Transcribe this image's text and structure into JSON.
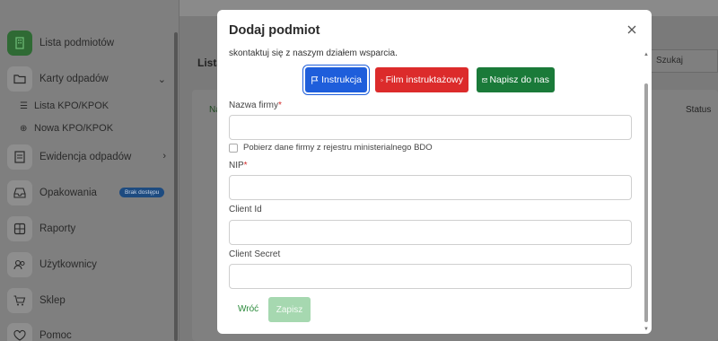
{
  "sidebar": {
    "items": [
      {
        "label": "Lista podmiotów",
        "icon": "building-icon"
      },
      {
        "label": "Karty odpadów",
        "icon": "folder-icon"
      },
      {
        "label": "Ewidencja odpadów",
        "icon": "document-icon"
      },
      {
        "label": "Opakowania",
        "icon": "inbox-icon",
        "badge": "Brak dostępu"
      },
      {
        "label": "Raporty",
        "icon": "grid-icon"
      },
      {
        "label": "Użytkownicy",
        "icon": "users-icon"
      },
      {
        "label": "Sklep",
        "icon": "cart-icon"
      },
      {
        "label": "Pomoc",
        "icon": "heart-icon"
      }
    ],
    "subitems": [
      {
        "label": "Lista KPO/KPOK",
        "icon": "list-icon"
      },
      {
        "label": "Nowa KPO/KPOK",
        "icon": "plus-circle-icon"
      }
    ]
  },
  "background": {
    "title": "Lista",
    "column_first": "Na",
    "column_status": "Status",
    "search_placeholder": "Szukaj"
  },
  "modal": {
    "title": "Dodaj podmiot",
    "support_text": "skontaktuj się z naszym działem wsparcia.",
    "buttons": {
      "instrukcja": "Instrukcja",
      "film": "Film instruktażowy",
      "napisz": "Napisz do nas"
    },
    "fields": {
      "nazwa_firmy": {
        "label": "Nazwa firmy",
        "required": "*",
        "value": ""
      },
      "bdo_checkbox": "Pobierz dane firmy z rejestru ministerialnego BDO",
      "nip": {
        "label": "NIP",
        "required": "*",
        "value": ""
      },
      "client_id": {
        "label": "Client Id",
        "value": ""
      },
      "client_secret": {
        "label": "Client Secret",
        "value": ""
      }
    },
    "footer": {
      "back": "Wróć",
      "save": "Zapisz"
    }
  },
  "colors": {
    "primary_blue": "#1e5edb",
    "danger_red": "#dc2b2b",
    "success_green": "#1a7a39",
    "save_disabled": "#a6d8b0",
    "required": "#d42b2b"
  }
}
